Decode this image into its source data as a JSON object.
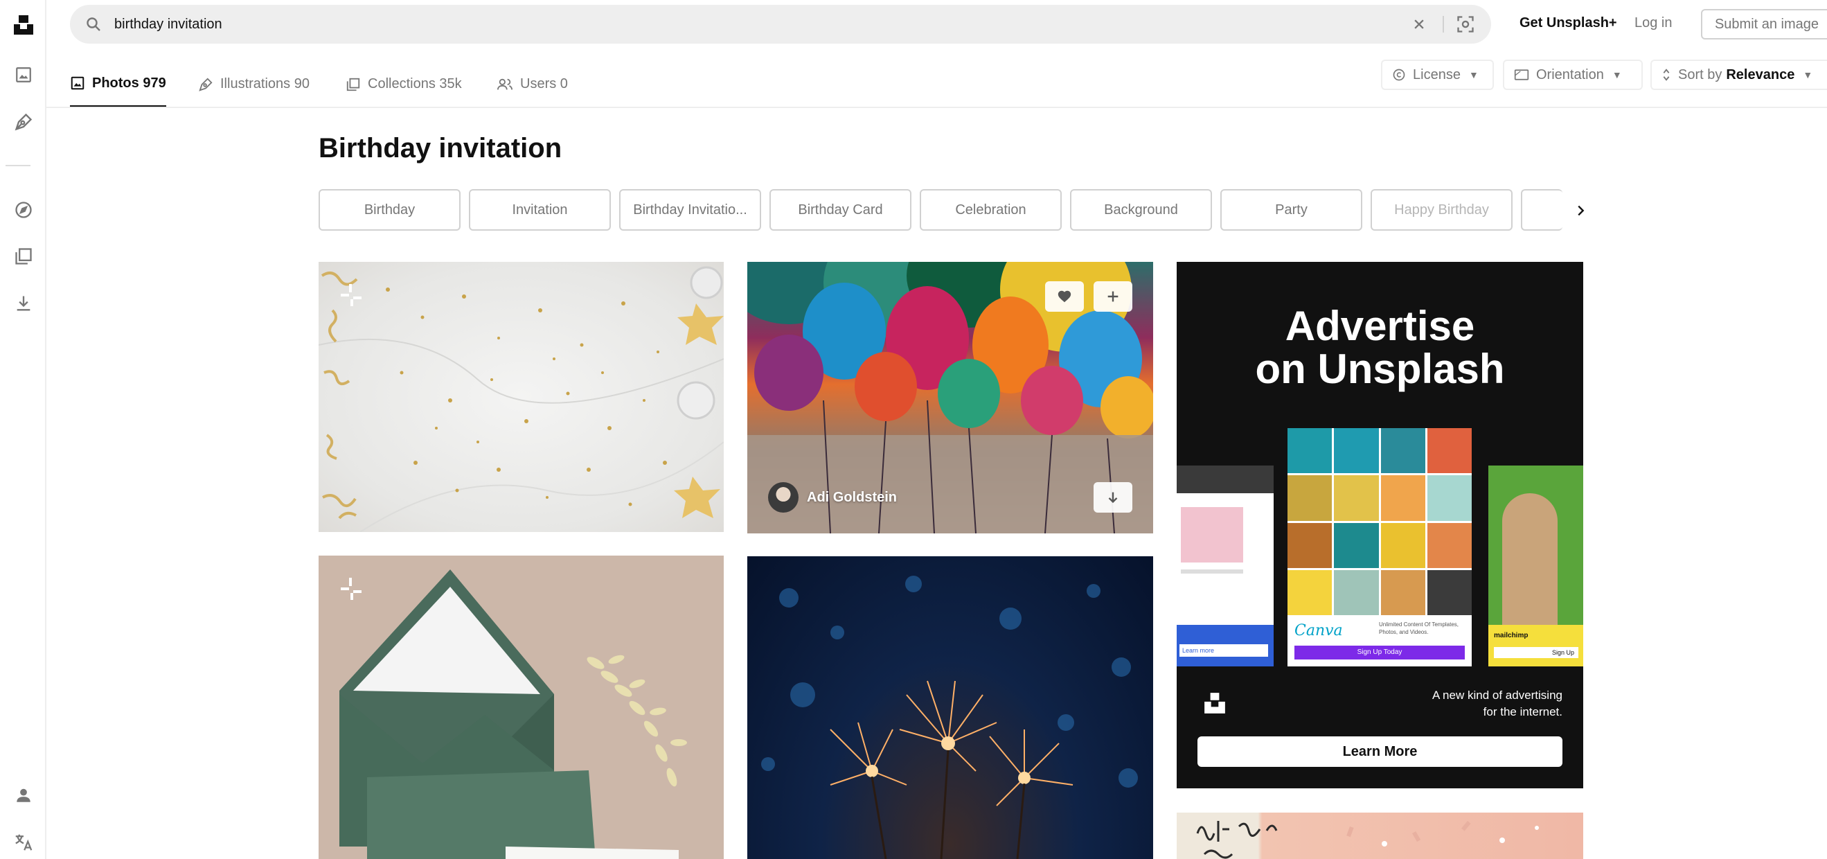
{
  "search": {
    "query": "birthday invitation"
  },
  "header": {
    "get_plus": "Get Unsplash+",
    "login": "Log in",
    "submit": "Submit an image"
  },
  "tabs": [
    {
      "label": "Photos",
      "count": "979"
    },
    {
      "label": "Illustrations",
      "count": "90"
    },
    {
      "label": "Collections",
      "count": "35k"
    },
    {
      "label": "Users",
      "count": "0"
    }
  ],
  "filters": {
    "license": "License",
    "orientation": "Orientation",
    "sort_prefix": "Sort by",
    "sort_value": "Relevance"
  },
  "page": {
    "title": "Birthday invitation"
  },
  "chips": [
    "Birthday",
    "Invitation",
    "Birthday Invitatio...",
    "Birthday Card",
    "Celebration",
    "Background",
    "Party",
    "Happy Birthday"
  ],
  "photos": {
    "author": "Adi Goldstein"
  },
  "ad": {
    "title_line1": "Advertise",
    "title_line2": "on Unsplash",
    "tagline_line1": "A new kind of advertising",
    "tagline_line2": "for the internet.",
    "button": "Learn More",
    "canva_brand": "Canva",
    "canva_text": "Unlimited Content Of Templates, Photos, and Videos.",
    "canva_cta": "Sign Up Today",
    "mock_left_cta": "Learn more",
    "mock_right_brand": "mailchimp",
    "mock_right_cta": "Sign Up"
  },
  "colors": {
    "accent": "#111111",
    "muted": "#767676",
    "border": "#d1d1d1",
    "canva_purple": "#7d2ae8"
  }
}
